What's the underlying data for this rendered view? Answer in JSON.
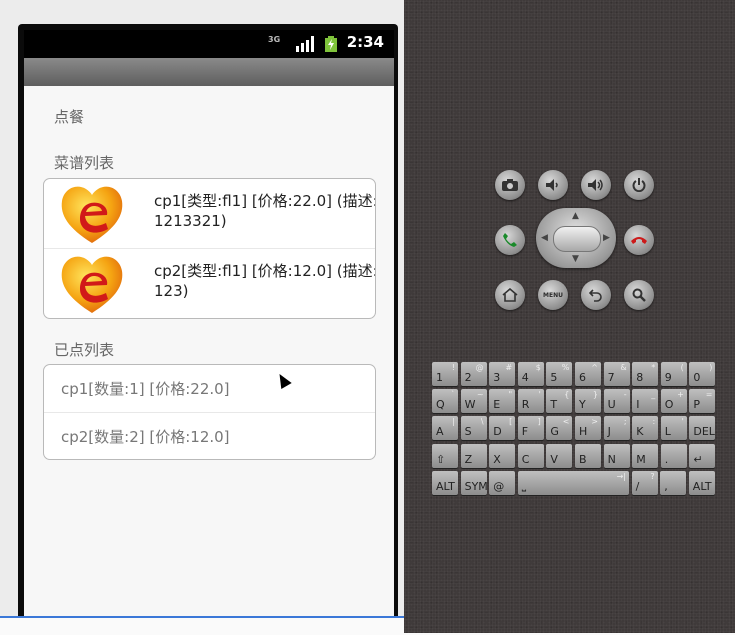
{
  "status_bar": {
    "network": "3G",
    "time": "2:34"
  },
  "app": {
    "title": "点餐",
    "menu_header": "菜谱列表",
    "ordered_header": "已点列表",
    "menu_items": [
      {
        "text": "cp1[类型:fl1] [价格:22.0] (描述:1213321)"
      },
      {
        "text": "cp2[类型:fl1] [价格:12.0] (描述:123)"
      }
    ],
    "ordered_items": [
      {
        "text": "cp1[数量:1] [价格:22.0]"
      },
      {
        "text": "cp2[数量:2] [价格:12.0]"
      }
    ]
  },
  "hardware": {
    "menu_label": "MENU",
    "keyboard": {
      "row1": [
        [
          "1",
          "!"
        ],
        [
          "2",
          "@"
        ],
        [
          "3",
          "#"
        ],
        [
          "4",
          "$"
        ],
        [
          "5",
          "%"
        ],
        [
          "6",
          "^"
        ],
        [
          "7",
          "&"
        ],
        [
          "8",
          "*"
        ],
        [
          "9",
          "("
        ],
        [
          "0",
          ")"
        ]
      ],
      "row2": [
        [
          "Q",
          "`"
        ],
        [
          "W",
          "~"
        ],
        [
          "E",
          "\""
        ],
        [
          "R",
          "'"
        ],
        [
          "T",
          "{"
        ],
        [
          "Y",
          "}"
        ],
        [
          "U",
          "-"
        ],
        [
          "I",
          "_"
        ],
        [
          "O",
          "+"
        ],
        [
          "P",
          "="
        ]
      ],
      "row3": [
        [
          "A",
          "|"
        ],
        [
          "S",
          "\\"
        ],
        [
          "D",
          "["
        ],
        [
          "F",
          "]"
        ],
        [
          "G",
          "<"
        ],
        [
          "H",
          ">"
        ],
        [
          "J",
          ";"
        ],
        [
          "K",
          ":"
        ],
        [
          "L",
          "'"
        ],
        [
          "DEL",
          ""
        ]
      ],
      "row4": [
        [
          "⇧",
          ""
        ],
        [
          "Z",
          ""
        ],
        [
          "X",
          ""
        ],
        [
          "C",
          ""
        ],
        [
          "V",
          ""
        ],
        [
          "B",
          ""
        ],
        [
          "N",
          ""
        ],
        [
          "M",
          ""
        ],
        [
          ".",
          ""
        ],
        [
          "↵",
          ""
        ]
      ],
      "row5": [
        [
          "ALT",
          ""
        ],
        [
          "SYM",
          ""
        ],
        [
          "@",
          ""
        ],
        [
          "⎵",
          "→|"
        ],
        [
          "/",
          "?"
        ],
        [
          ",",
          ""
        ],
        [
          "ALT",
          ""
        ]
      ]
    }
  }
}
